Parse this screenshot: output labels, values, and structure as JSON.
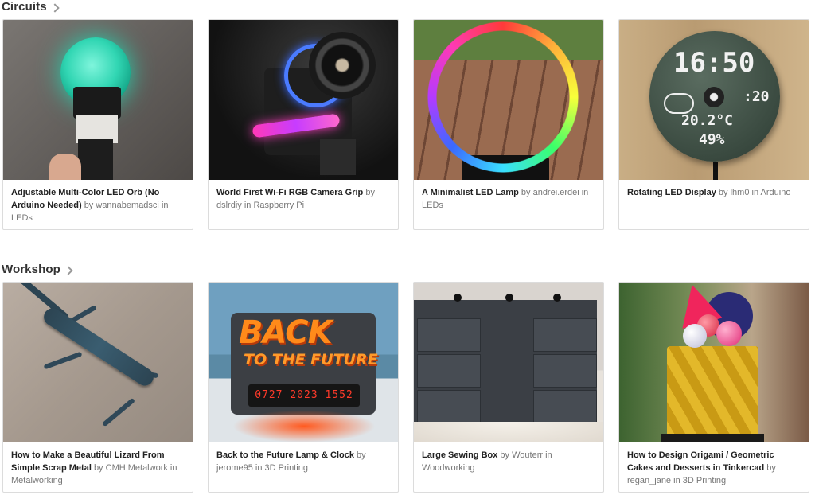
{
  "sections": [
    {
      "title": "Circuits",
      "cards": [
        {
          "title": "Adjustable Multi-Color LED Orb (No Arduino Needed)",
          "author": "wannabemadsci",
          "category": "LEDs",
          "image": "led-orb-photo"
        },
        {
          "title": "World First Wi-Fi RGB Camera Grip",
          "author": "dslrdiy",
          "category": "Raspberry Pi",
          "image": "camera-grip-photo"
        },
        {
          "title": "A Minimalist LED Lamp",
          "author": "andrei.erdei",
          "category": "LEDs",
          "image": "led-ring-lamp-photo"
        },
        {
          "title": "Rotating LED Display",
          "author": "lhm0",
          "category": "Arduino",
          "image": "rotating-display-photo",
          "display": {
            "time": "16:50",
            "seconds": ":20",
            "temp": "20.2°C",
            "humidity": "49%"
          }
        }
      ]
    },
    {
      "title": "Workshop",
      "cards": [
        {
          "title": "How to Make a Beautiful Lizard From Simple Scrap Metal",
          "author": "CMH Metalwork",
          "category": "Metalworking",
          "image": "metal-lizard-photo"
        },
        {
          "title": "Back to the Future Lamp & Clock",
          "author": "jerome95",
          "category": "3D Printing",
          "image": "bttf-lamp-photo",
          "logo": {
            "line1": "BACK",
            "line2": "TO THE FUTURE",
            "clock": "0727 2023 1552"
          }
        },
        {
          "title": "Large Sewing Box",
          "author": "Wouterr",
          "category": "Woodworking",
          "image": "sewing-box-photo"
        },
        {
          "title": "How to Design Origami / Geometric Cakes and Desserts in Tinkercad",
          "author": "regan_jane",
          "category": "3D Printing",
          "image": "geometric-cake-photo"
        }
      ]
    }
  ],
  "labels": {
    "by": "by",
    "in": "in"
  }
}
